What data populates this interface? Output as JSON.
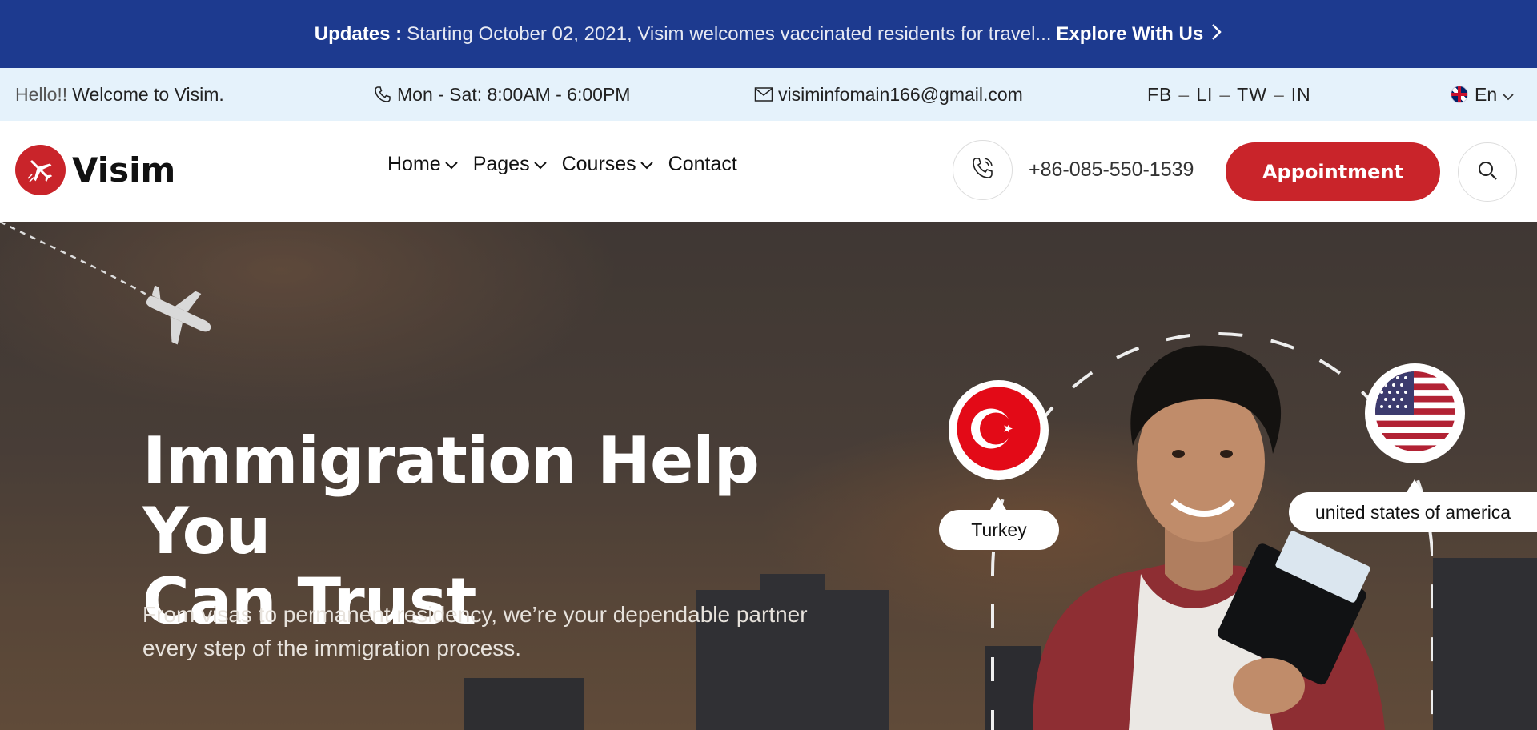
{
  "announcement": {
    "lead": "Updates :",
    "message": "Starting October 02, 2021, Visim welcomes vaccinated residents for travel...",
    "cta": "Explore With Us"
  },
  "infobar": {
    "hello_prefix": "Hello!!",
    "hello_text": "Welcome to Visim.",
    "hours": "Mon - Sat: 8:00AM - 6:00PM",
    "email": "visiminfomain166@gmail.com",
    "social": [
      "FB",
      "LI",
      "TW",
      "IN"
    ],
    "social_sep": "–",
    "language": "En"
  },
  "header": {
    "brand": "Visim",
    "nav": [
      {
        "label": "Home",
        "has_dropdown": true
      },
      {
        "label": "Pages",
        "has_dropdown": true
      },
      {
        "label": "Courses",
        "has_dropdown": true
      },
      {
        "label": "Contact",
        "has_dropdown": false
      }
    ],
    "phone": "+86-085-550-1539",
    "appointment_label": "Appointment"
  },
  "hero": {
    "title_line1": "Immigration Help You",
    "title_line2": "Can Trust",
    "subtitle_line1": "From visas to permanent residency, we’re your dependable partner",
    "subtitle_line2": "every step of the immigration process.",
    "badges": [
      {
        "country": "Turkey",
        "flag": "turkey-flag-icon"
      },
      {
        "country": "united states of america",
        "flag": "usa-flag-icon"
      }
    ]
  },
  "colors": {
    "announcement_bg": "#1d3a8f",
    "infobar_bg": "#e5f2fb",
    "brand_red": "#c9242a"
  }
}
